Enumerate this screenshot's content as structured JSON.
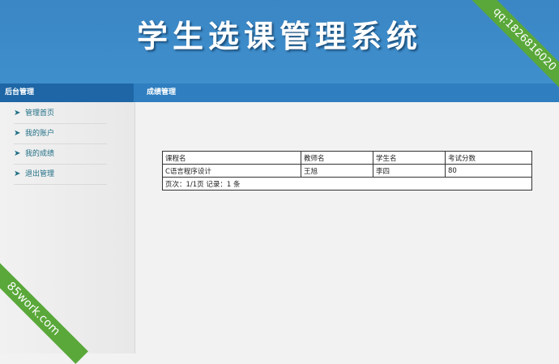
{
  "header": {
    "title": "学生选课管理系统"
  },
  "navbar": {
    "left_label": "后台管理",
    "right_label": "成绩管理"
  },
  "sidebar": {
    "items": [
      {
        "label": "管理首页"
      },
      {
        "label": "我的账户"
      },
      {
        "label": "我的成绩"
      },
      {
        "label": "退出管理"
      }
    ]
  },
  "table": {
    "columns": [
      "课程名",
      "教师名",
      "学生名",
      "考试分数"
    ],
    "rows": [
      [
        "C语言程序设计",
        "王旭",
        "李四",
        "80"
      ]
    ],
    "footer": "页次：1/1页 记录：1 条"
  },
  "watermarks": {
    "top_right": "qq:1826816020",
    "bottom_left": "85work.com"
  },
  "colors": {
    "header_blue": "#3f8fcd",
    "nav_blue": "#2f7fc0",
    "nav_dark": "#1e66a6",
    "ribbon_green": "#5aa83a",
    "link_teal": "#1f6f85"
  }
}
